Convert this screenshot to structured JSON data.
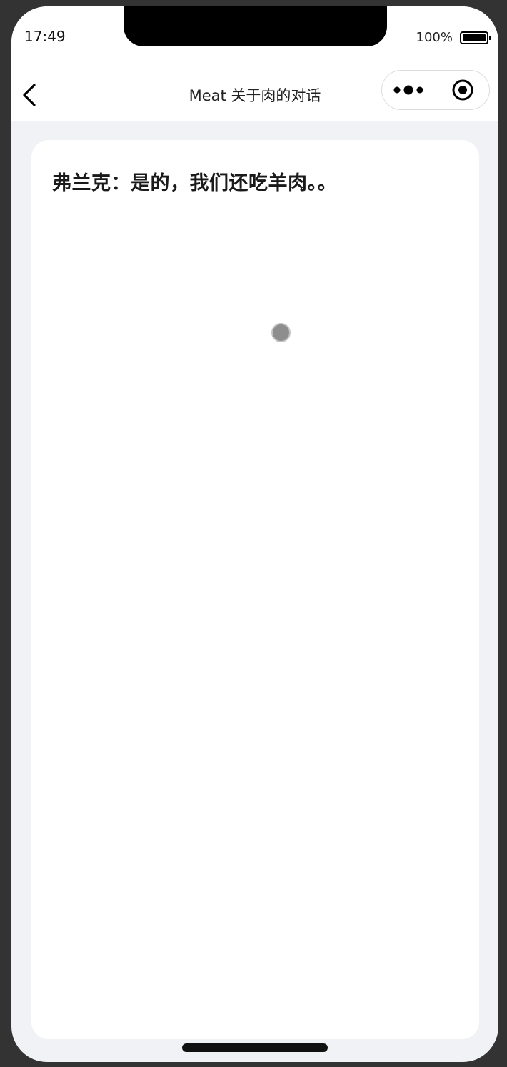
{
  "status_bar": {
    "time": "17:49",
    "battery_percent": "100%",
    "battery_level": 1.0
  },
  "nav": {
    "title": "Meat 关于肉的对话",
    "back_icon": "chevron-left-icon",
    "more_icon": "more-dots-icon",
    "close_icon": "target-circle-icon"
  },
  "content": {
    "text": "弗兰克：是的，我们还吃羊肉。。"
  },
  "colors": {
    "background": "#f1f2f5",
    "card": "#ffffff",
    "text": "#1a1a1a",
    "loading": "#8e8e8e"
  }
}
